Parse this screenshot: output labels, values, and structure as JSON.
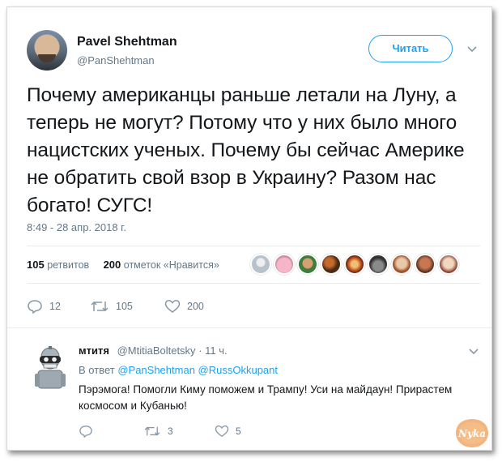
{
  "tweet": {
    "author_name": "Pavel Shehtman",
    "author_handle": "@PanShehtman",
    "follow_label": "Читать",
    "text": "Почему американцы раньше летали на Луну, а теперь не могут? Потому что у них было много нацистских ученых. Почему бы сейчас Америке не обратить свой взор в Украину? Разом нас богато! СУГС!",
    "timestamp": "8:49 - 28 апр. 2018 г.",
    "retweets_count": "105",
    "retweets_label": "ретвитов",
    "likes_count": "200",
    "likes_label": "отметок «Нравится»",
    "actions": {
      "replies": "12",
      "retweets": "105",
      "likes": "200"
    }
  },
  "reply": {
    "author_name": "мтитя",
    "author_handle": "@MtitiaBoltetsky",
    "time": "· 11 ч.",
    "in_reply_prefix": "В ответ",
    "mention_1": "@PanShehtman",
    "mention_2": "@RussOkkupant",
    "text": "Пэрэмога! Помогли Киму поможем и Трампу! Уси на майдаун! Прирастем космосом и Кубанью!",
    "actions": {
      "retweets": "3",
      "likes": "5"
    }
  },
  "watermark_text": "Nyka",
  "colors": {
    "accent": "#1da1f2",
    "secondary_text": "#657786",
    "divider": "#e6ecf0"
  },
  "icons": {
    "reply": "reply-icon",
    "retweet": "retweet-icon",
    "like": "heart-icon",
    "more": "chevron-down-icon"
  }
}
